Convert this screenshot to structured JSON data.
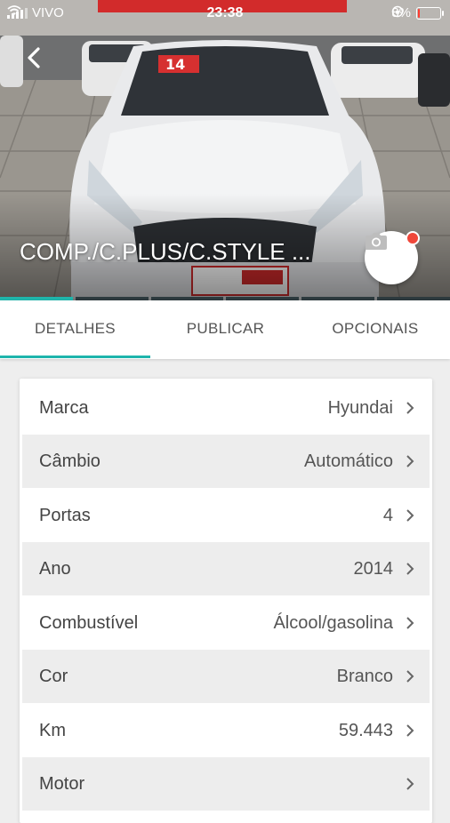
{
  "status_bar": {
    "carrier": "VIVO",
    "time": "23:38",
    "battery_text": "8%",
    "battery_level": 0.08
  },
  "header": {
    "title": "COMP./C.PLUS/C.STYLE ..."
  },
  "tabs": [
    {
      "label": "DETALHES",
      "active": true
    },
    {
      "label": "PUBLICAR",
      "active": false
    },
    {
      "label": "OPCIONAIS",
      "active": false
    }
  ],
  "details": [
    {
      "label": "Marca",
      "value": "Hyundai"
    },
    {
      "label": "Câmbio",
      "value": "Automático"
    },
    {
      "label": "Portas",
      "value": "4"
    },
    {
      "label": "Ano",
      "value": "2014"
    },
    {
      "label": "Combustível",
      "value": "Álcool/gasolina"
    },
    {
      "label": "Cor",
      "value": "Branco"
    },
    {
      "label": "Km",
      "value": "59.443"
    },
    {
      "label": "Motor",
      "value": ""
    }
  ],
  "colors": {
    "accent": "#1fb5ac",
    "notification_dot": "#f0473a",
    "row_alt": "#ededed"
  },
  "icons": {
    "back": "chevron-left-icon",
    "camera": "camera-icon",
    "row": "chevron-right-icon"
  }
}
